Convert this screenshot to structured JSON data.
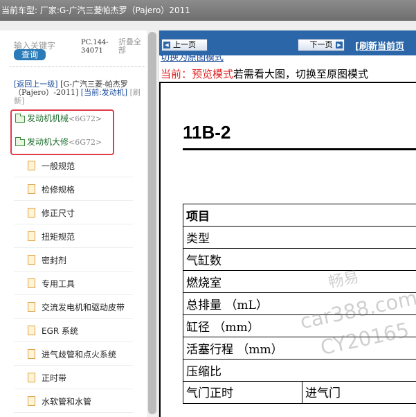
{
  "title_bar": "当前车型:  厂家:G-广汽三菱帕杰罗（Pajero）2011",
  "sidebar": {
    "search_placeholder": "输入关键字",
    "search_button": "查询",
    "code": "PC.144-34071",
    "collapse_all": "折叠全部",
    "back_link": "[返回上一级]",
    "parent": "[G-广汽三菱-帕杰罗（Pajero）-2011]",
    "current_prefix": "[当前:",
    "current_name": "发动机]",
    "refresh": "[刷新]",
    "folders": [
      {
        "label": "发动机机械",
        "code": "<6G72>"
      },
      {
        "label": "发动机大修",
        "code": "<6G72>"
      }
    ],
    "items": [
      "一般规范",
      "检修规格",
      "修正尺寸",
      "扭矩规范",
      "密封剂",
      "专用工具",
      "交流发电机和驱动皮带",
      "EGR 系统",
      "进气歧管和点火系统",
      "正时带",
      "水软管和水管"
    ]
  },
  "toolbar": {
    "prev": "上一页",
    "next": "下一页",
    "refresh_page": "[刷新当前页"
  },
  "mode": {
    "switch_link": "切换为原图模式",
    "current_label": "当前：预览模式",
    "hint": "若需看大图，切换至原图模式"
  },
  "document": {
    "heading": "11B-2",
    "table_rows": [
      "项目",
      "类型",
      "气缸数",
      "燃烧室",
      "总排量 （mL）",
      "缸径 （mm）",
      "活塞行程 （mm）",
      "压缩比"
    ],
    "last_row": [
      "气门正时",
      "进气门"
    ]
  },
  "watermark": [
    "畅易",
    "car388.com",
    "CY20165"
  ],
  "colors": {
    "toolbar": "#2a66a8",
    "highlight": "#e03c4a",
    "folder_text": "#1c6e2c",
    "preview_mode": "#e02020"
  }
}
